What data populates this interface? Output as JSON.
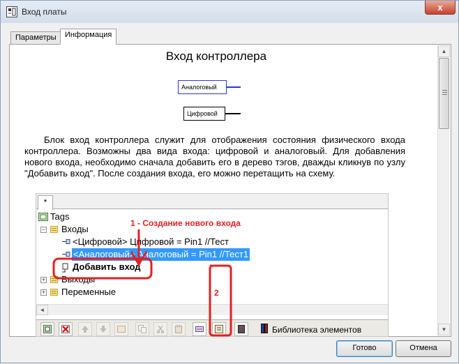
{
  "window": {
    "title": "Вход платы",
    "close_glyph": "x"
  },
  "tabs": [
    {
      "label": "Параметры"
    },
    {
      "label": "Информация"
    }
  ],
  "doc": {
    "heading": "Вход  контроллера",
    "analog_block": "Аналоговый",
    "digital_block": "Цифровой",
    "paragraph": "Блок вход контроллера служит для отображения состояния физического входа контроллера. Возможны два вида входа: цифровой и аналоговый. Для добавления нового входа, необходимо сначала добавить его в дерево тэгов, дважды кликнув по узлу \"Добавить вход\". После создания входа, его можно перетащить на схему."
  },
  "embedded": {
    "tab_label": "*",
    "tree": {
      "root": "Tags",
      "inputs": "Входы",
      "digital_item": "<Цифровой> Цифровой = Pin1  //Тест",
      "analog_item": "<Аналоговый> Аналоговый = Pin1  //Тест1",
      "add_input": "Добавить вход",
      "outputs": "Выходы",
      "variables": "Переменные"
    },
    "library_label": "Библиотека элементов"
  },
  "annotations": {
    "step1": "1 - Создание нового входа",
    "step2": "2"
  },
  "buttons": {
    "ok": "Готово",
    "cancel": "Отмена"
  },
  "colors": {
    "annotation": "#e32020",
    "selection": "#3399ff",
    "analog_block_border": "#2a3ad0",
    "digital_block_border": "#000000"
  },
  "icons": [
    "app-icon",
    "close-icon",
    "tags-root-icon",
    "folder-icon",
    "tag-icon",
    "add-input-icon",
    "toolbar-icons",
    "library-icon"
  ]
}
